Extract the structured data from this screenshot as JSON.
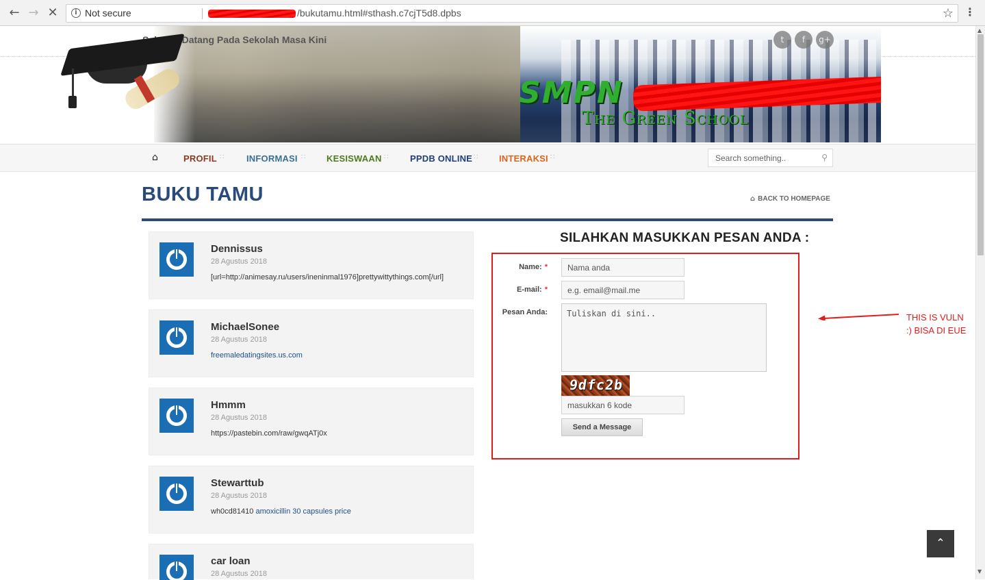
{
  "browser": {
    "security_label": "Not secure",
    "url_path": "/bukutamu.html#sthash.c7cjT5d8.dpbs",
    "back_icon": "arrow-left-icon",
    "forward_icon": "arrow-right-icon",
    "stop_icon": "close-icon"
  },
  "header": {
    "welcome": "Selamat Datang Pada Sekolah Masa Kini",
    "school_name": "SMPN",
    "tagline": "The Green School",
    "social_icons": [
      "twitter-icon",
      "facebook-icon",
      "google-plus-icon"
    ]
  },
  "nav": {
    "home_icon": "home-icon",
    "items": [
      {
        "label": "PROFIL",
        "color": "#8b3a1e"
      },
      {
        "label": "INFORMASI",
        "color": "#3b6f94"
      },
      {
        "label": "KESISWAAN",
        "color": "#4f7a1e"
      },
      {
        "label": "PPDB ONLINE",
        "color": "#1f3f7a"
      },
      {
        "label": "INTERAKSI",
        "color": "#e0631a"
      }
    ],
    "search_placeholder": "Search something.."
  },
  "page": {
    "title": "BUKU TAMU",
    "back_link": "BACK TO HOMEPAGE"
  },
  "entries": [
    {
      "name": "Dennissus",
      "date": "28 Agustus 2018",
      "message": "[url=http://animesay.ru/users/ineninmal1976]prettywittythings.com[/url]",
      "message_link": ""
    },
    {
      "name": "MichaelSonee",
      "date": "28 Agustus 2018",
      "message": "",
      "message_link": "freemaledatingsites.us.com"
    },
    {
      "name": "Hmmm",
      "date": "28 Agustus 2018",
      "message": "https://pastebin.com/raw/gwqATj0x",
      "message_link": ""
    },
    {
      "name": "Stewarttub",
      "date": "28 Agustus 2018",
      "message": "wh0cd81410 ",
      "message_link": "amoxicillin 30 capsules price"
    },
    {
      "name": "car loan",
      "date": "28 Agustus 2018",
      "message": "",
      "message_link": ""
    }
  ],
  "form": {
    "title": "SILAHKAN MASUKKAN PESAN ANDA :",
    "name_label": "Name:",
    "name_placeholder": "Nama anda",
    "email_label": "E-mail:",
    "email_placeholder": "e.g. email@mail.me",
    "message_label": "Pesan Anda:",
    "message_placeholder": "Tuliskan di sini..",
    "required_mark": "*",
    "captcha_text": "9dfc2b",
    "captcha_placeholder": "masukkan 6 kode",
    "send_label": "Send a Message"
  },
  "annotation": {
    "line1": "THIS IS VULN",
    "line2": ":) BISA DI EUE",
    "color": "#e31b1b"
  }
}
